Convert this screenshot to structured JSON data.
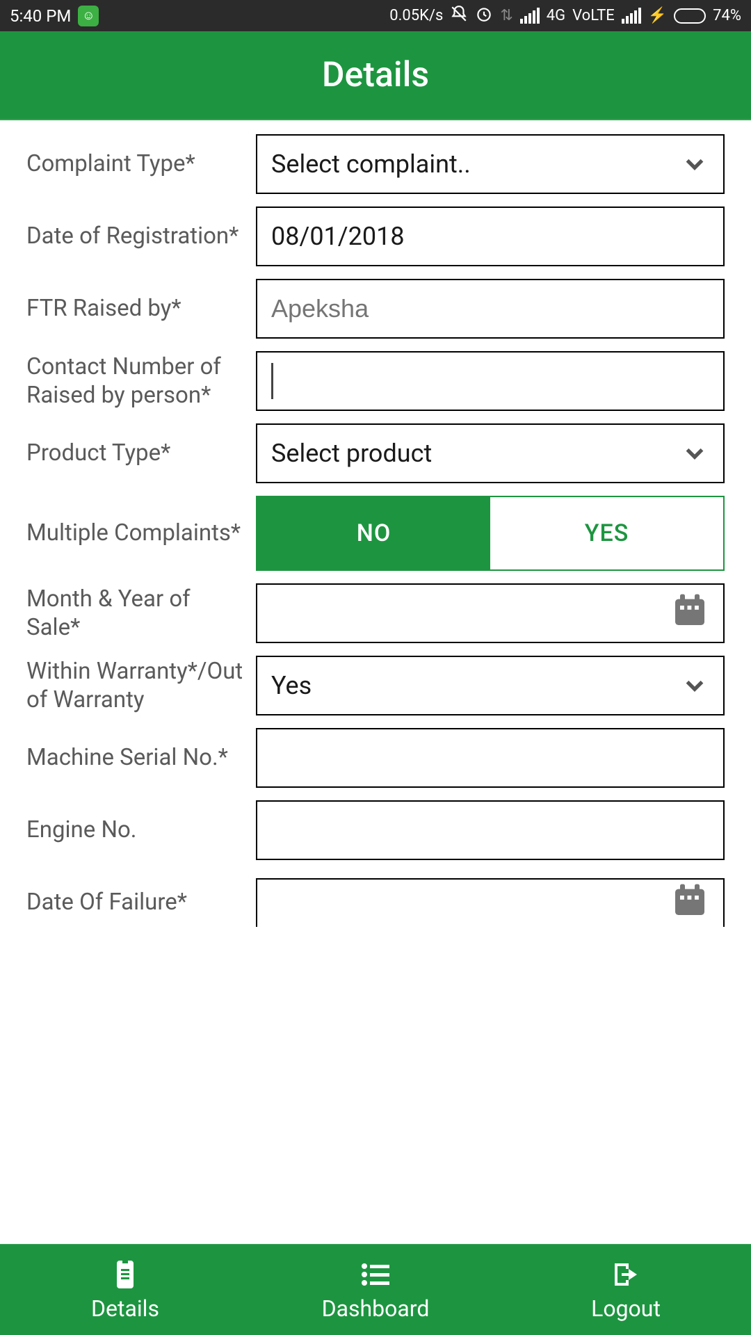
{
  "status": {
    "time": "5:40 PM",
    "net_speed": "0.05K/s",
    "network_label": "4G",
    "volte": "VoLTE",
    "battery_pct": "74%"
  },
  "header": {
    "title": "Details"
  },
  "fields": {
    "complaint_type": {
      "label": "Complaint Type*",
      "value": "Select complaint.."
    },
    "date_reg": {
      "label": "Date of Registration*",
      "value": "08/01/2018"
    },
    "ftr_by": {
      "label": "FTR Raised by*",
      "placeholder": "Apeksha"
    },
    "contact_no": {
      "label": "Contact Number of Raised by person*",
      "value": ""
    },
    "product_type": {
      "label": "Product Type*",
      "value": "Select product"
    },
    "multi_complaints": {
      "label": "Multiple Complaints*",
      "no": "NO",
      "yes": "YES",
      "selected": "NO"
    },
    "sale_date": {
      "label": "Month & Year of Sale*",
      "value": ""
    },
    "warranty": {
      "label": "Within Warranty*/Out of Warranty",
      "value": "Yes"
    },
    "serial": {
      "label": "Machine Serial No.*",
      "value": ""
    },
    "engine": {
      "label": "Engine No.",
      "value": ""
    },
    "failure_date": {
      "label": "Date Of Failure*",
      "value": ""
    }
  },
  "nav": {
    "details": "Details",
    "dashboard": "Dashboard",
    "logout": "Logout"
  }
}
